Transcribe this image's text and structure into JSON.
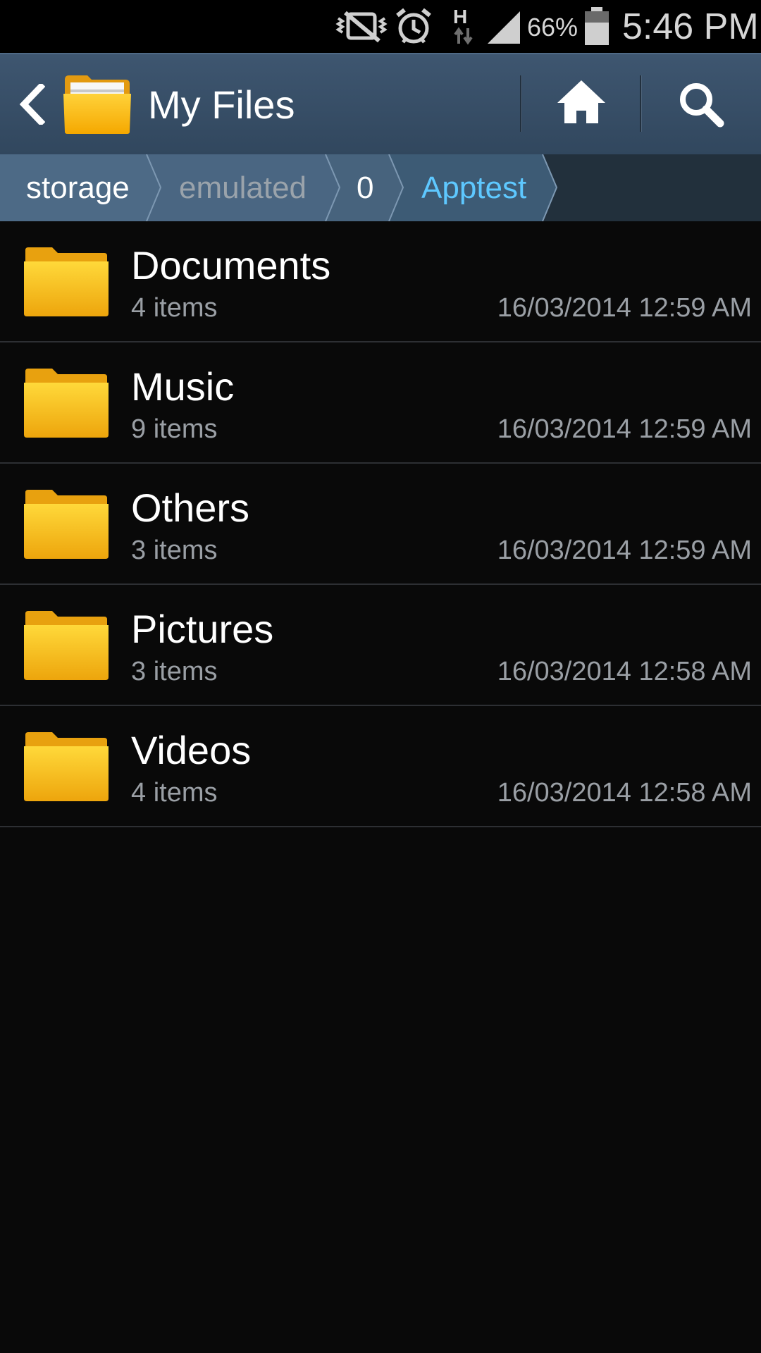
{
  "status_bar": {
    "battery_percent": "66%",
    "time": "5:46 PM",
    "network_type": "H",
    "icons": [
      "vibrate-mute-icon",
      "alarm-icon",
      "hspa-data-icon",
      "signal-icon",
      "battery-icon"
    ]
  },
  "action_bar": {
    "title": "My Files",
    "icons": [
      "back-arrow-icon",
      "folder-app-icon",
      "home-icon",
      "search-icon"
    ]
  },
  "breadcrumb": {
    "items": [
      "storage",
      "emulated",
      "0",
      "Apptest"
    ],
    "colors": {
      "normal": "#ffffff",
      "dimmed": "#9aa3ab",
      "active": "#5ec8ff"
    }
  },
  "files": [
    {
      "name": "Documents",
      "count": "4 items",
      "date": "16/03/2014 12:59 AM"
    },
    {
      "name": "Music",
      "count": "9 items",
      "date": "16/03/2014 12:59 AM"
    },
    {
      "name": "Others",
      "count": "3 items",
      "date": "16/03/2014 12:59 AM"
    },
    {
      "name": "Pictures",
      "count": "3 items",
      "date": "16/03/2014 12:58 AM"
    },
    {
      "name": "Videos",
      "count": "4 items",
      "date": "16/03/2014 12:58 AM"
    }
  ],
  "colors": {
    "action_bar": "#3a5069",
    "background": "#090909",
    "folder": "#f2b81a",
    "accent": "#5ec8ff"
  }
}
